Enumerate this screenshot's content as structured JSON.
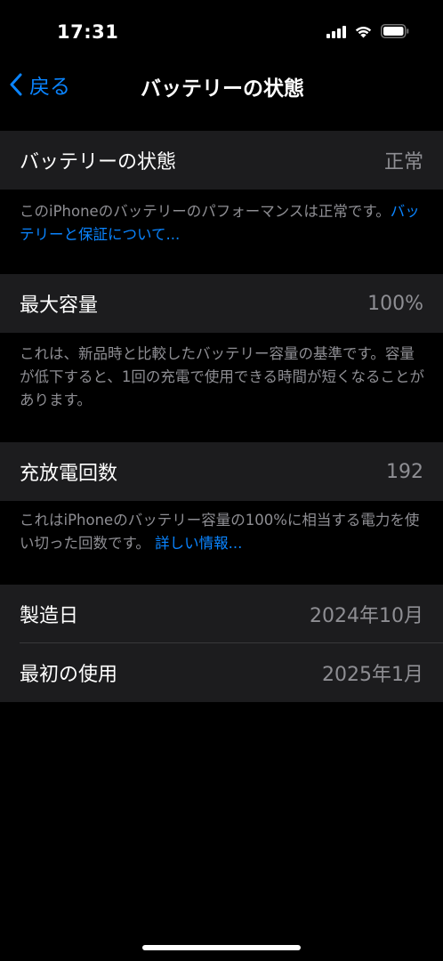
{
  "status_bar": {
    "time": "17:31",
    "icons": [
      "cellular-signal-icon",
      "wifi-icon",
      "battery-icon"
    ]
  },
  "nav": {
    "back_label": "戻る",
    "title": "バッテリーの状態"
  },
  "sections": {
    "health": {
      "label": "バッテリーの状態",
      "value": "正常",
      "footer_text": "このiPhoneのバッテリーのパフォーマンスは正常です。",
      "footer_link": "バッテリーと保証について..."
    },
    "capacity": {
      "label": "最大容量",
      "value": "100%",
      "footer_text": "これは、新品時と比較したバッテリー容量の基準です。容量が低下すると、1回の充電で使用できる時間が短くなることがあります。"
    },
    "cycles": {
      "label": "充放電回数",
      "value": "192",
      "footer_text": "これはiPhoneのバッテリー容量の100%に相当する電力を使い切った回数です。 ",
      "footer_link": "詳しい情報..."
    },
    "dates": {
      "manufacture_label": "製造日",
      "manufacture_value": "2024年10月",
      "first_use_label": "最初の使用",
      "first_use_value": "2025年1月"
    }
  },
  "colors": {
    "background": "#000000",
    "cell": "#1c1c1e",
    "accent": "#0a84ff",
    "secondary_text": "#8e8e93"
  }
}
